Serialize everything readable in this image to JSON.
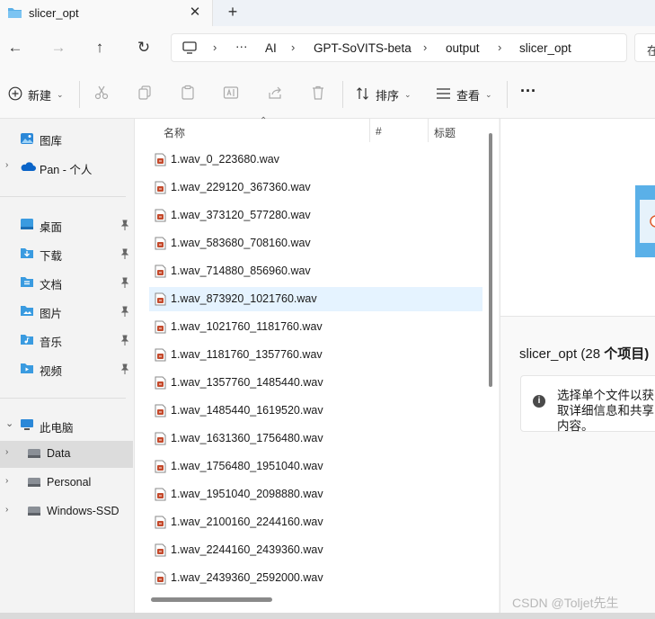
{
  "tab": {
    "title": "slicer_opt",
    "close_glyph": "✕",
    "new_glyph": "+"
  },
  "address": {
    "crumbs": [
      "AI",
      "GPT-SoVITS-beta",
      "output",
      "slicer_opt"
    ],
    "overflow": "···",
    "search_placeholder": "在"
  },
  "toolbar": {
    "new_label": "新建",
    "sort_label": "排序",
    "view_label": "查看",
    "more": "···"
  },
  "navpane": {
    "top": [
      {
        "label": "图库",
        "icon": "gallery-icon"
      },
      {
        "label": "Pan - 个人",
        "icon": "cloud-icon"
      }
    ],
    "quick": [
      {
        "label": "桌面",
        "icon": "desktop-folder-icon"
      },
      {
        "label": "下载",
        "icon": "downloads-folder-icon"
      },
      {
        "label": "文档",
        "icon": "documents-folder-icon"
      },
      {
        "label": "图片",
        "icon": "pictures-folder-icon"
      },
      {
        "label": "音乐",
        "icon": "music-folder-icon"
      },
      {
        "label": "视频",
        "icon": "videos-folder-icon"
      }
    ],
    "pc": {
      "label": "此电脑"
    },
    "drives": [
      {
        "label": "Data",
        "selected": true
      },
      {
        "label": "Personal",
        "selected": false
      },
      {
        "label": "Windows-SSD",
        "selected": false
      }
    ]
  },
  "filelist": {
    "columns": [
      "名称",
      "#",
      "标题"
    ],
    "files": [
      "1.wav_0_223680.wav",
      "1.wav_229120_367360.wav",
      "1.wav_373120_577280.wav",
      "1.wav_583680_708160.wav",
      "1.wav_714880_856960.wav",
      "1.wav_873920_1021760.wav",
      "1.wav_1021760_1181760.wav",
      "1.wav_1181760_1357760.wav",
      "1.wav_1357760_1485440.wav",
      "1.wav_1485440_1619520.wav",
      "1.wav_1631360_1756480.wav",
      "1.wav_1756480_1951040.wav",
      "1.wav_1951040_2098880.wav",
      "1.wav_2100160_2244160.wav",
      "1.wav_2244160_2439360.wav",
      "1.wav_2439360_2592000.wav"
    ],
    "selected_index": 5
  },
  "details": {
    "folder_name": "slicer_opt (28 ",
    "count_text": "个项目)",
    "info_text": "选择单个文件以获取详细信息和共享内容。"
  },
  "watermark": "CSDN @Toljet先生",
  "colors": {
    "accent": "#0067c0",
    "selected_row": "#e5f3ff",
    "folder": "#5ab0e8"
  }
}
